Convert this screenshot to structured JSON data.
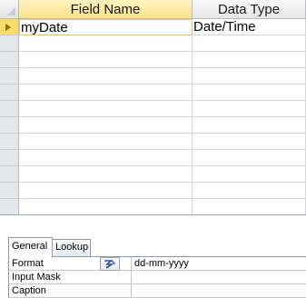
{
  "grid": {
    "headers": {
      "field_name": "Field Name",
      "data_type": "Data Type"
    },
    "rows": [
      {
        "field_name": "myDate",
        "data_type": "Date/Time",
        "active": true
      }
    ],
    "empty_row_count": 11
  },
  "field_properties": {
    "tabs": [
      {
        "label": "General",
        "selected": true
      },
      {
        "label": "Lookup",
        "selected": false
      }
    ],
    "properties": [
      {
        "label": "Format",
        "value": "dd-mm-yyyy",
        "has_builder": true
      },
      {
        "label": "Input Mask",
        "value": ""
      },
      {
        "label": "Caption",
        "value": ""
      }
    ]
  },
  "icons": {
    "row_selector": "current-row-arrow-icon",
    "builder": "format-builder-icon"
  },
  "colors": {
    "active_header": "#fbe28a",
    "active_selector": "#f9dd6a",
    "grid_lines": "#d4d8de"
  }
}
